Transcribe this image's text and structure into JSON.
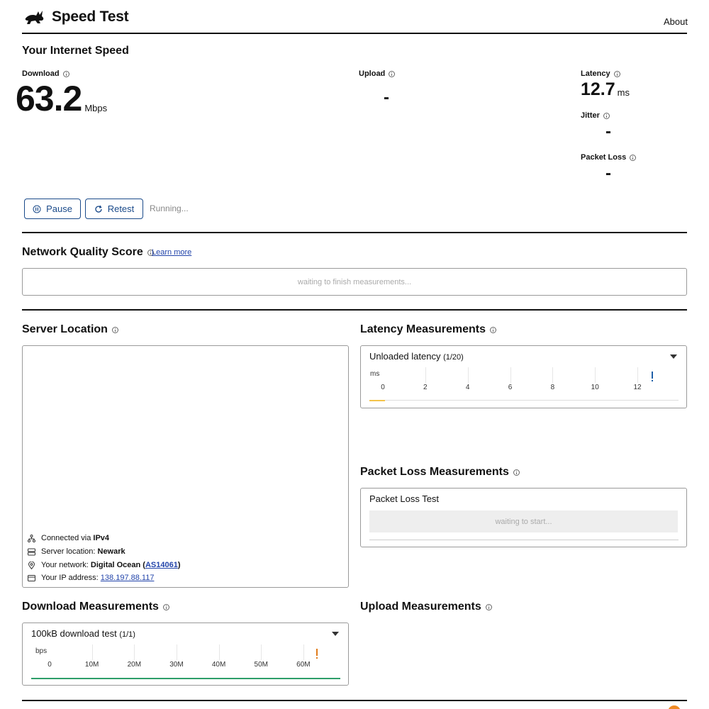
{
  "header": {
    "app_title": "Speed Test",
    "about_label": "About"
  },
  "speed": {
    "title": "Your Internet Speed",
    "download": {
      "label": "Download",
      "value": "63.2",
      "unit": "Mbps"
    },
    "upload": {
      "label": "Upload",
      "value": "-"
    },
    "latency": {
      "label": "Latency",
      "value": "12.7",
      "unit": "ms"
    },
    "jitter": {
      "label": "Jitter",
      "value": "-"
    },
    "packet_loss": {
      "label": "Packet Loss",
      "value": "-"
    }
  },
  "controls": {
    "pause_label": "Pause",
    "retest_label": "Retest",
    "status": "Running..."
  },
  "quality": {
    "title": "Network Quality Score",
    "learn_more": "Learn more",
    "waiting": "waiting to finish measurements..."
  },
  "server": {
    "title": "Server Location",
    "connected_label": "Connected via",
    "connected_value": "IPv4",
    "location_label": "Server location:",
    "location_value": "Newark",
    "network_label": "Your network:",
    "network_value": "Digital Ocean",
    "network_open": "(",
    "network_asn": "AS14061",
    "network_close": ")",
    "ip_label": "Your IP address:",
    "ip_value": "138.197.88.117"
  },
  "latency_measurements": {
    "title": "Latency Measurements",
    "selected": "Unloaded latency",
    "count": "(1/20)",
    "unit": "ms",
    "ticks": [
      "0",
      "2",
      "4",
      "6",
      "8",
      "10",
      "12"
    ],
    "tick_values": [
      0,
      2,
      4,
      6,
      8,
      10,
      12
    ],
    "axis_max": 12.7,
    "marker_value": 12.7,
    "progress": 0.05,
    "marker_color": "#1f5fa8",
    "bar_color": "#f3c34a"
  },
  "packet_loss_measurements": {
    "title": "Packet Loss Measurements",
    "test_label": "Packet Loss Test",
    "waiting": "waiting to start..."
  },
  "download_measurements": {
    "title": "Download Measurements",
    "selected": "100kB download test",
    "count": "(1/1)",
    "unit": "bps",
    "ticks": [
      "0",
      "10M",
      "20M",
      "30M",
      "40M",
      "50M",
      "60M"
    ],
    "tick_values": [
      0,
      10,
      20,
      30,
      40,
      50,
      60
    ],
    "axis_max": 63.2,
    "marker_value": 63.2,
    "progress": 1.0,
    "marker_color": "#e07b1a",
    "bar_color": "#2e9e6a"
  },
  "upload_measurements": {
    "title": "Upload Measurements"
  },
  "colors": {
    "accent": "#1a4a8a",
    "orange_badge": "#f08a24"
  }
}
